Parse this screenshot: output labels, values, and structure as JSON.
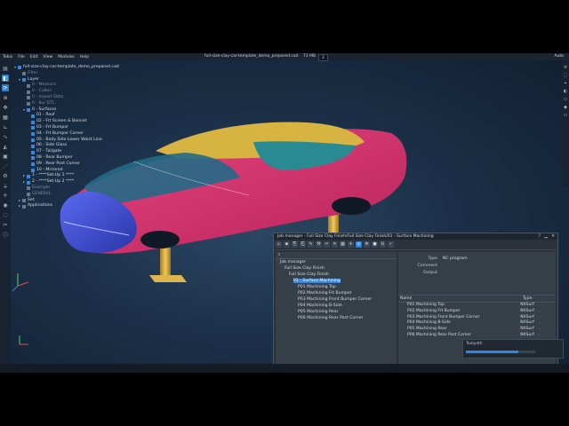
{
  "app": {
    "menu": [
      "Tebis",
      "File",
      "Edit",
      "View",
      "Modules",
      "Help"
    ],
    "window_title": "full-size-clay-car-template_demo_prepared.cad",
    "file_size": "73 MB",
    "tab_count": "2",
    "workspace_label": "Auto"
  },
  "tree": {
    "rows": [
      {
        "indent": 0,
        "tw": "▾",
        "color": "#3b86d6",
        "label": "full-size-clay-car-template_demo_prepared.cad",
        "dim": false
      },
      {
        "indent": 1,
        "tw": "",
        "color": "#6b7a8a",
        "label": "Filter",
        "dim": true
      },
      {
        "indent": 1,
        "tw": "▾",
        "color": "#3b86d6",
        "label": "Layer",
        "dim": false
      },
      {
        "indent": 2,
        "tw": "",
        "color": "#6b7a8a",
        "label": "0 - Measure",
        "dim": true
      },
      {
        "indent": 2,
        "tw": "",
        "color": "#6b7a8a",
        "label": "0 - Cubes",
        "dim": true
      },
      {
        "indent": 2,
        "tw": "",
        "color": "#6b7a8a",
        "label": "0 - Import Data",
        "dim": true
      },
      {
        "indent": 2,
        "tw": "",
        "color": "#6b7a8a",
        "label": "0 - Kur DTL",
        "dim": true
      },
      {
        "indent": 2,
        "tw": "▾",
        "color": "#3b86d6",
        "label": "0 - Surfaces",
        "dim": false
      },
      {
        "indent": 3,
        "tw": "",
        "color": "#3b86d6",
        "label": "01 - Roof",
        "dim": false
      },
      {
        "indent": 3,
        "tw": "",
        "color": "#3b86d6",
        "label": "02 - Frt Screen & Bonnet",
        "dim": false
      },
      {
        "indent": 3,
        "tw": "",
        "color": "#3b86d6",
        "label": "03 - Frt Bumper",
        "dim": false
      },
      {
        "indent": 3,
        "tw": "",
        "color": "#3b86d6",
        "label": "04 - Frt Bumper Corner",
        "dim": false
      },
      {
        "indent": 3,
        "tw": "",
        "color": "#3b86d6",
        "label": "05 - Body Side Lower Waist Line",
        "dim": false
      },
      {
        "indent": 3,
        "tw": "",
        "color": "#3b86d6",
        "label": "06 - Side Glass",
        "dim": false
      },
      {
        "indent": 3,
        "tw": "",
        "color": "#3b86d6",
        "label": "07 - Tailgate",
        "dim": false
      },
      {
        "indent": 3,
        "tw": "",
        "color": "#3b86d6",
        "label": "08 - Rear Bumper",
        "dim": false
      },
      {
        "indent": 3,
        "tw": "",
        "color": "#3b86d6",
        "label": "09 - Rear Post Corner",
        "dim": false
      },
      {
        "indent": 3,
        "tw": "",
        "color": "#3b86d6",
        "label": "10 - Mirrored",
        "dim": false
      },
      {
        "indent": 2,
        "tw": "▸",
        "color": "#3b86d6",
        "label": "1 - ****Set-Up 1 ****",
        "dim": false
      },
      {
        "indent": 2,
        "tw": "▸",
        "color": "#3b86d6",
        "label": "2 - ****Set-Up 2 ****",
        "dim": false
      },
      {
        "indent": 2,
        "tw": "",
        "color": "#6b7a8a",
        "label": "Example",
        "dim": true
      },
      {
        "indent": 2,
        "tw": "",
        "color": "#6b7a8a",
        "label": "GENERAL",
        "dim": true
      },
      {
        "indent": 1,
        "tw": "▸",
        "color": "#6b7a8a",
        "label": "Set",
        "dim": false
      },
      {
        "indent": 1,
        "tw": "▸",
        "color": "#6b7a8a",
        "label": "Applications",
        "dim": false
      }
    ]
  },
  "dialog": {
    "title": "Job manager - Full Size Clay Finish/Full Size Clay Finish/01 - Surface Machining",
    "tree": [
      {
        "indent": 1,
        "label": "Job manager",
        "selected": false
      },
      {
        "indent": 2,
        "label": "Full Size Clay Finish",
        "selected": false
      },
      {
        "indent": 3,
        "label": "Full Size Clay Finish",
        "selected": false
      },
      {
        "indent": 4,
        "label": "01 - Surface Machining",
        "selected": true
      },
      {
        "indent": 5,
        "label": "P01 Machining Top",
        "selected": false
      },
      {
        "indent": 5,
        "label": "P02 Machining Frt Bumper",
        "selected": false
      },
      {
        "indent": 5,
        "label": "P03 Machining Front Bumper Corner",
        "selected": false
      },
      {
        "indent": 5,
        "label": "P04 Machining B-Side",
        "selected": false
      },
      {
        "indent": 5,
        "label": "P05 Machining Rear",
        "selected": false
      },
      {
        "indent": 5,
        "label": "P06 Machining Rear Post Corner",
        "selected": false
      }
    ],
    "props": [
      {
        "key": "Type",
        "value": "NC program"
      },
      {
        "key": "Comment",
        "value": ""
      },
      {
        "key": "Output",
        "value": ""
      }
    ],
    "list_header": {
      "name": "Name",
      "type": "Type"
    },
    "list": [
      {
        "name": "P01 Machining Top",
        "type": "NXSurf"
      },
      {
        "name": "P02 Machining Frt Bumper",
        "type": "NXSurf"
      },
      {
        "name": "P03 Machining Front Bumper Corner",
        "type": "NXSurf"
      },
      {
        "name": "P04 Machining B-Side",
        "type": "NXSurf"
      },
      {
        "name": "P05 Machining Rear",
        "type": "NXSurf"
      },
      {
        "name": "P06 Machining Rear Post Corner",
        "type": "NXSurf"
      }
    ],
    "list_suffix": "..."
  },
  "status": {
    "label": "Toolpath",
    "progress": 0.75
  },
  "colors": {
    "accent": "#2a7fd4",
    "body_pink": "#d6336c",
    "roof_yellow": "#d7b341",
    "glass_teal": "#2a8a92",
    "bumper_blue": "#3b4bd1",
    "stand_gold": "#d2a13a"
  },
  "icons": {
    "left_toolbar": [
      "select-icon",
      "layers-icon",
      "rotate-icon",
      "zoom-icon",
      "pan-icon",
      "grid-icon",
      "measure-icon",
      "curve-icon",
      "surface-icon",
      "solid-icon",
      "toolpath-icon",
      "settings-icon",
      "filter-icon",
      "snap-icon",
      "view-icon",
      "hide-icon",
      "cut-icon",
      "info-icon",
      "help-icon"
    ]
  }
}
